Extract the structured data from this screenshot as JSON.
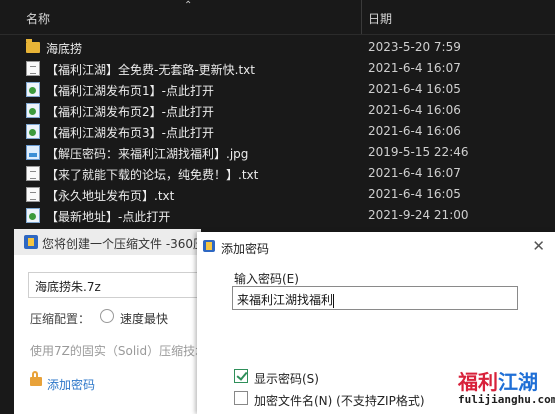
{
  "explorer": {
    "columns": {
      "name": "名称",
      "date": "日期"
    },
    "rows": [
      {
        "icon": "folder-icon",
        "name": "海底捞",
        "date": "2023-5-20 7:59"
      },
      {
        "icon": "text-file-icon",
        "name": "【福利江湖】全免费-无套路-更新快.txt",
        "date": "2021-6-4 16:07"
      },
      {
        "icon": "url-shortcut-icon",
        "name": "【福利江湖发布页1】-点此打开",
        "date": "2021-6-4 16:05"
      },
      {
        "icon": "url-shortcut-icon",
        "name": "【福利江湖发布页2】-点此打开",
        "date": "2021-6-4 16:06"
      },
      {
        "icon": "url-shortcut-icon",
        "name": "【福利江湖发布页3】-点此打开",
        "date": "2021-6-4 16:06"
      },
      {
        "icon": "image-file-icon",
        "name": "【解压密码：来福利江湖找福利】.jpg",
        "date": "2019-5-15 22:46"
      },
      {
        "icon": "text-file-icon",
        "name": "【来了就能下载的论坛，纯免费！】.txt",
        "date": "2021-6-4 16:07"
      },
      {
        "icon": "text-file-icon",
        "name": "【永久地址发布页】.txt",
        "date": "2021-6-4 16:05"
      },
      {
        "icon": "url-shortcut-icon",
        "name": "【最新地址】-点此打开",
        "date": "2021-9-24 21:00"
      }
    ]
  },
  "zip_dialog": {
    "title": "您将创建一个压缩文件 -360压缩",
    "filename": "海底捞朱.7z",
    "config_label": "压缩配置：",
    "speed_option": "速度最快",
    "solid_text": "使用7Z的固实（Solid）压缩技术",
    "add_password": "添加密码"
  },
  "password_dialog": {
    "title": "添加密码",
    "input_label": "输入密码(E)",
    "password_value": "来福利江湖找福利",
    "show_password": "显示密码(S)",
    "show_password_checked": true,
    "encrypt_names": "加密文件名(N) (不支持ZIP格式)",
    "encrypt_names_checked": false
  },
  "watermark": {
    "line1_part1": "福利",
    "line1_part2": "江湖",
    "line2": "fulijianghu.com"
  },
  "colors": {
    "explorer_bg": "#191919",
    "accent_red": "#d8213a",
    "accent_blue": "#1f6fd6",
    "check_green": "#2f8f5a"
  }
}
